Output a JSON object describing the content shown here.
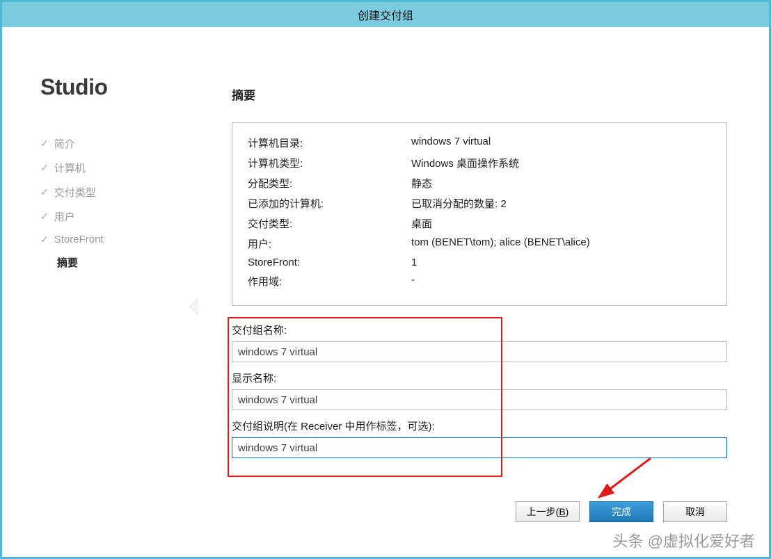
{
  "title": "创建交付组",
  "sidebar": {
    "brand": "Studio",
    "steps": [
      {
        "label": "简介",
        "done": true
      },
      {
        "label": "计算机",
        "done": true
      },
      {
        "label": "交付类型",
        "done": true
      },
      {
        "label": "用户",
        "done": true
      },
      {
        "label": "StoreFront",
        "done": true
      },
      {
        "label": "摘要",
        "done": false,
        "active": true
      }
    ]
  },
  "main": {
    "heading": "摘要",
    "summary": [
      {
        "label": "计算机目录:",
        "value": "windows 7 virtual"
      },
      {
        "label": "计算机类型:",
        "value": "Windows 桌面操作系统"
      },
      {
        "label": "分配类型:",
        "value": "静态"
      },
      {
        "label": "已添加的计算机:",
        "value": "已取消分配的数量: 2"
      },
      {
        "label": "交付类型:",
        "value": "桌面"
      },
      {
        "label": "用户:",
        "value": "tom (BENET\\tom); alice (BENET\\alice)"
      },
      {
        "label": "StoreFront:",
        "value": "1"
      },
      {
        "label": "作用域:",
        "value": "-"
      }
    ],
    "fields": {
      "group_name_label": "交付组名称:",
      "group_name_value": "windows 7 virtual",
      "display_name_label": "显示名称:",
      "display_name_value": "windows 7 virtual",
      "description_label": "交付组说明(在 Receiver 中用作标签，可选):",
      "description_value": "windows 7 virtual"
    }
  },
  "buttons": {
    "back_prefix": "上一步(",
    "back_key": "B",
    "back_suffix": ")",
    "finish": "完成",
    "cancel": "取消"
  },
  "watermark": "头条 @虚拟化爱好者"
}
